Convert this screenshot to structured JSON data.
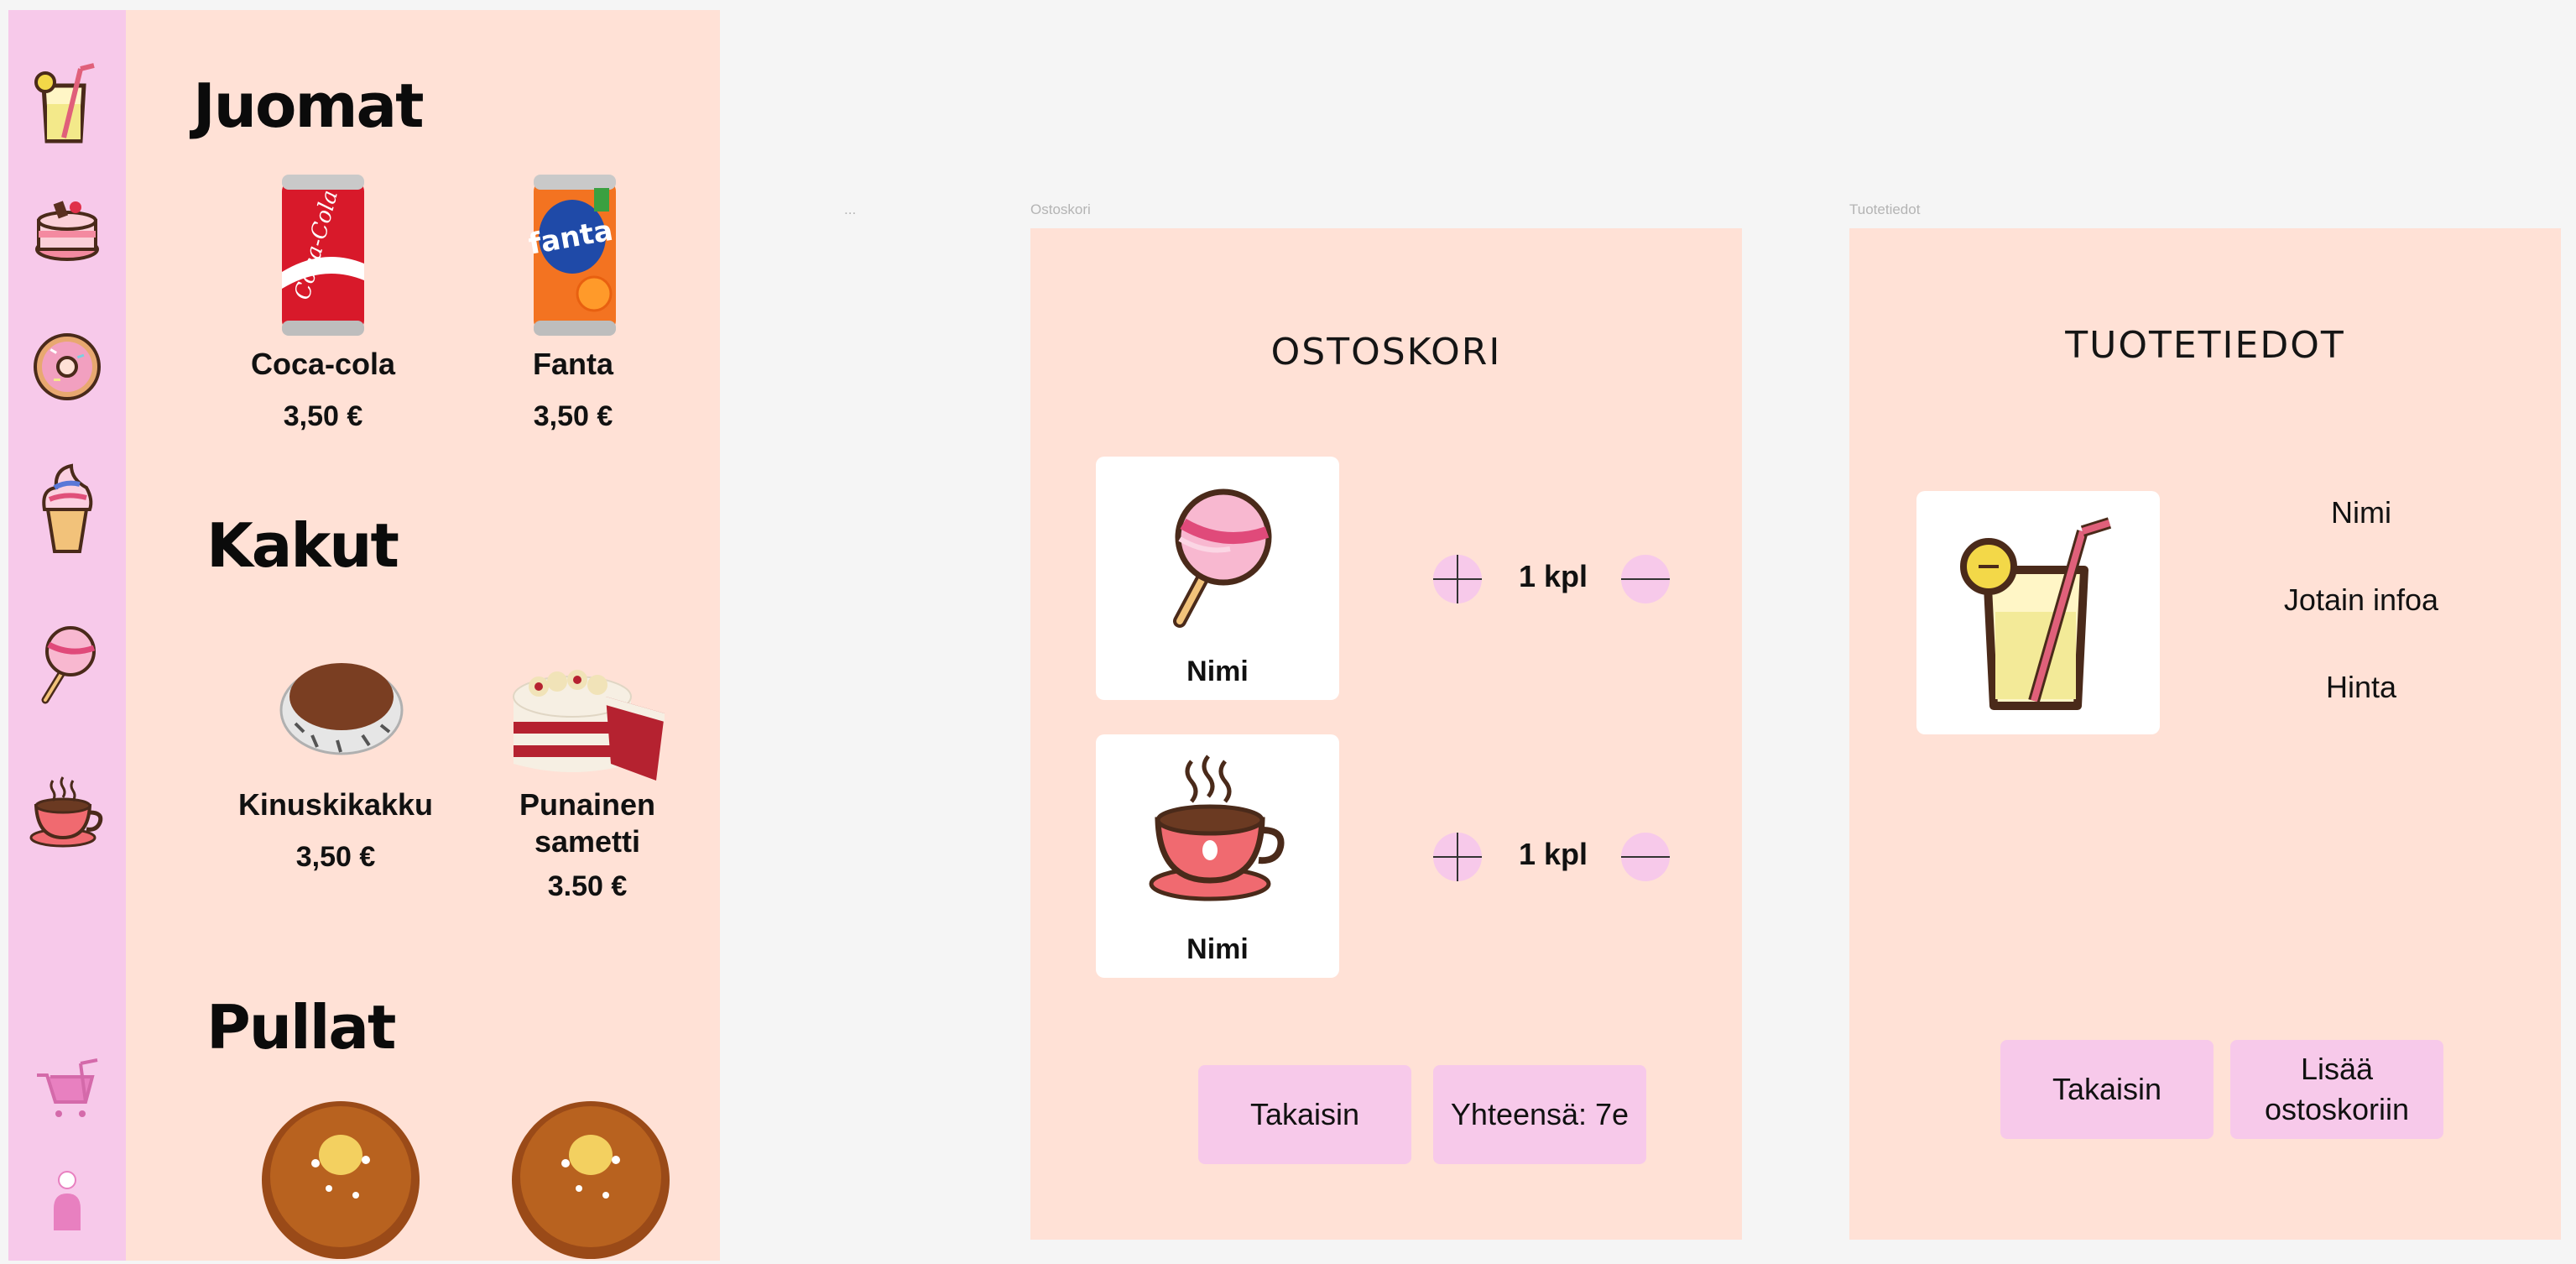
{
  "sidebar": {
    "icons": [
      "drink-icon",
      "cake-icon",
      "donut-icon",
      "ice-cream-icon",
      "lollipop-icon",
      "coffee-icon",
      "cart-icon",
      "user-icon"
    ]
  },
  "menu": {
    "sections": [
      {
        "title": "Juomat",
        "products": [
          {
            "name": "Coca-cola",
            "price": "3,50 €",
            "image": "coca-cola-can"
          },
          {
            "name": "Fanta",
            "price": "3,50 €",
            "image": "fanta-can"
          }
        ]
      },
      {
        "title": "Kakut",
        "products": [
          {
            "name": "Kinuskikakku",
            "price": "3,50 €",
            "image": "kinuskikakku-cake"
          },
          {
            "name": "Punainen\nsametti",
            "price": "3.50 €",
            "image": "red-velvet-cake"
          }
        ]
      },
      {
        "title": "Pullat",
        "products": [
          {
            "name": "",
            "price": "",
            "image": "bun"
          },
          {
            "name": "",
            "price": "",
            "image": "bun"
          }
        ]
      }
    ]
  },
  "frame_labels": {
    "small": "...",
    "cart": "Ostoskori",
    "details": "Tuotetiedot"
  },
  "cart": {
    "title": "OSTOSKORI",
    "items": [
      {
        "name": "Nimi",
        "quantity": "1 kpl",
        "icon": "lollipop-icon"
      },
      {
        "name": "Nimi",
        "quantity": "1 kpl",
        "icon": "coffee-cup-icon"
      }
    ],
    "back_label": "Takaisin",
    "total_label": "Yhteensä: 7e"
  },
  "details": {
    "title": "TUOTETIEDOT",
    "icon": "lemonade-icon",
    "name": "Nimi",
    "info": "Jotain infoa",
    "price": "Hinta",
    "back_label": "Takaisin",
    "add_label": "Lisää\nostoskoriin"
  },
  "colors": {
    "sidebar_pink": "#f7c9ea",
    "panel_peach": "#ffe1d6",
    "canvas": "#f5f5f5"
  }
}
